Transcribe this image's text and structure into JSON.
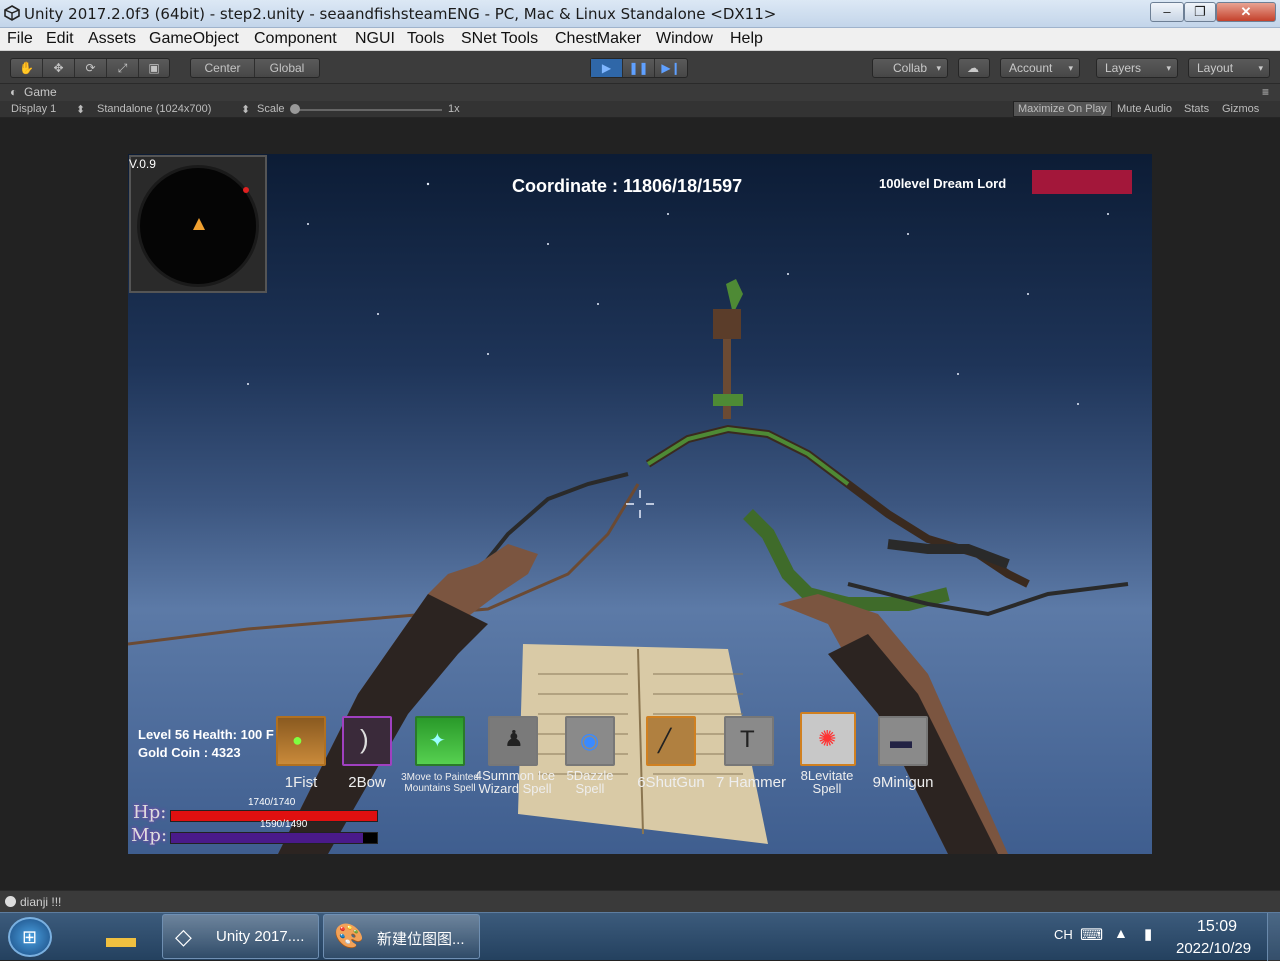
{
  "window": {
    "title": "Unity 2017.2.0f3 (64bit) - step2.unity - seaandfishsteamENG - PC, Mac & Linux Standalone <DX11>",
    "min": "–",
    "max": "❐",
    "close": "✕"
  },
  "menu": [
    "File",
    "Edit",
    "Assets",
    "GameObject",
    "Component",
    "NGUI",
    "Tools",
    "SNet Tools",
    "ChestMaker",
    "Window",
    "Help"
  ],
  "toolbar": {
    "pivot": "Center",
    "space": "Global",
    "collab": "Collab",
    "account": "Account",
    "layers": "Layers",
    "layout": "Layout"
  },
  "game_tab": {
    "title": "Game",
    "display": "Display 1",
    "resolution": "Standalone (1024x700)",
    "scale_label": "Scale",
    "scale_value": "1x",
    "maximize": "Maximize On Play",
    "mute": "Mute Audio",
    "stats": "Stats",
    "gizmos": "Gizmos"
  },
  "hud": {
    "version": "V.0.9",
    "coordinate": "Coordinate : 11806/18/1597",
    "boss_name": "100level Dream Lord",
    "boss_bar_color": "#a3173a",
    "level_health": "Level 56 Health: 100 F",
    "gold": "Gold Coin : 4323",
    "hp_label": "Hp:",
    "mp_label": "Mp:",
    "hp_text": "1740/1740",
    "mp_text": "1590/1490",
    "hp_fraction": 1.0,
    "mp_fraction": 0.93,
    "hotbar": [
      {
        "label": "1Fist",
        "icon": "fist-icon"
      },
      {
        "label": "2Bow",
        "icon": "bow-icon"
      },
      {
        "label": "3Move to Painted Mountains Spell",
        "icon": "portal-spell-icon"
      },
      {
        "label": "4Summon Ice Wizard Spell",
        "icon": "ice-wizard-icon"
      },
      {
        "label": "5Dazzle Spell",
        "icon": "dazzle-icon"
      },
      {
        "label": "6ShutGun",
        "icon": "shotgun-icon"
      },
      {
        "label": "7 Hammer",
        "icon": "hammer-icon"
      },
      {
        "label": "8Levitate Spell",
        "icon": "levitate-icon"
      },
      {
        "label": "9Minigun",
        "icon": "minigun-icon"
      }
    ]
  },
  "console": "dianji !!!",
  "taskbar": {
    "task1": "Unity 2017....",
    "task2": "新建位图图...",
    "lang": "CH",
    "time": "15:09",
    "date": "2022/10/29"
  }
}
